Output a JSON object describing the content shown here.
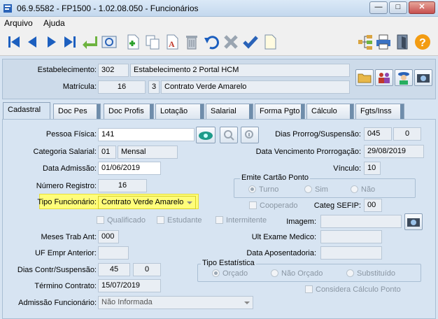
{
  "window": {
    "title": "06.9.5582 - FP1500 - 1.02.08.050 - Funcionários",
    "min": "—",
    "max": "□",
    "close": "✕"
  },
  "menu": [
    "Arquivo",
    "Ajuda"
  ],
  "toolbar_icons": [
    "first-icon",
    "prev-icon",
    "next-icon",
    "last-icon",
    "return-icon",
    "search-icon",
    "new-icon",
    "copy-icon",
    "text-icon",
    "delete-icon",
    "undo-icon",
    "cancel-icon",
    "confirm-icon",
    "note-icon",
    "tree-icon",
    "print-icon",
    "exit-icon",
    "help-icon"
  ],
  "header": {
    "estabelecimento_label": "Estabelecimento:",
    "estabelecimento_code": "302",
    "estabelecimento_name": "Estabelecimento 2 Portal HCM",
    "matricula_label": "Matrícula:",
    "matricula_value": "16",
    "contrato_code": "3",
    "contrato_name": "Contrato Verde Amarelo"
  },
  "tabs": [
    "Cadastral",
    "Doc Pes",
    "Doc Profis",
    "Lotação",
    "Salarial",
    "Forma Pgto",
    "Cálculo",
    "Fgts/Inss"
  ],
  "form": {
    "pessoa_fisica_label": "Pessoa Física:",
    "pessoa_fisica_value": "141",
    "categoria_label": "Categoria Salarial:",
    "categoria_code": "01",
    "categoria_name": "Mensal",
    "admissao_label": "Data Admissão:",
    "admissao_value": "01/06/2019",
    "registro_label": "Número Registro:",
    "registro_value": "16",
    "tipo_func_label": "Tipo Funcionário:",
    "tipo_func_value": "Contrato Verde Amarelo",
    "qualificado": "Qualificado",
    "estudante": "Estudante",
    "intermitente": "Intermitente",
    "meses_label": "Meses Trab Ant:",
    "meses_value": "000",
    "uf_label": "UF Empr Anterior:",
    "uf_value": "",
    "dias_contr_label": "Dias Contr/Suspensão:",
    "dias_contr_a": "45",
    "dias_contr_b": "0",
    "termino_label": "Término Contrato:",
    "termino_value": "15/07/2019",
    "admissao_func_label": "Admissão Funcionário:",
    "admissao_func_value": "Não Informada",
    "dias_prorrog_label": "Dias Prorrog/Suspensão:",
    "dias_prorrog_a": "045",
    "dias_prorrog_b": "0",
    "venc_prorrog_label": "Data Vencimento Prorrogação:",
    "venc_prorrog_value": "29/08/2019",
    "vinculo_label": "Vínculo:",
    "vinculo_value": "10",
    "emite_group": "Emite Cartão Ponto",
    "emite_turno": "Turno",
    "emite_sim": "Sim",
    "emite_nao": "Não",
    "cooperado": "Cooperado",
    "sefip_label": "Categ SEFIP:",
    "sefip_value": "00",
    "imagem_label": "Imagem:",
    "ult_exame_label": "Ult Exame Medico:",
    "aposentadoria_label": "Data Aposentadoria:",
    "tipo_est_group": "Tipo Estatística",
    "est_orcado": "Orçado",
    "est_nao_orcado": "Não Orçado",
    "est_substituido": "Substituído",
    "considera": "Considera Cálculo Ponto"
  },
  "colors": {
    "highlight": "#fffd7a",
    "panel": "#d7e4f2",
    "accent": "#1c5fbf"
  }
}
